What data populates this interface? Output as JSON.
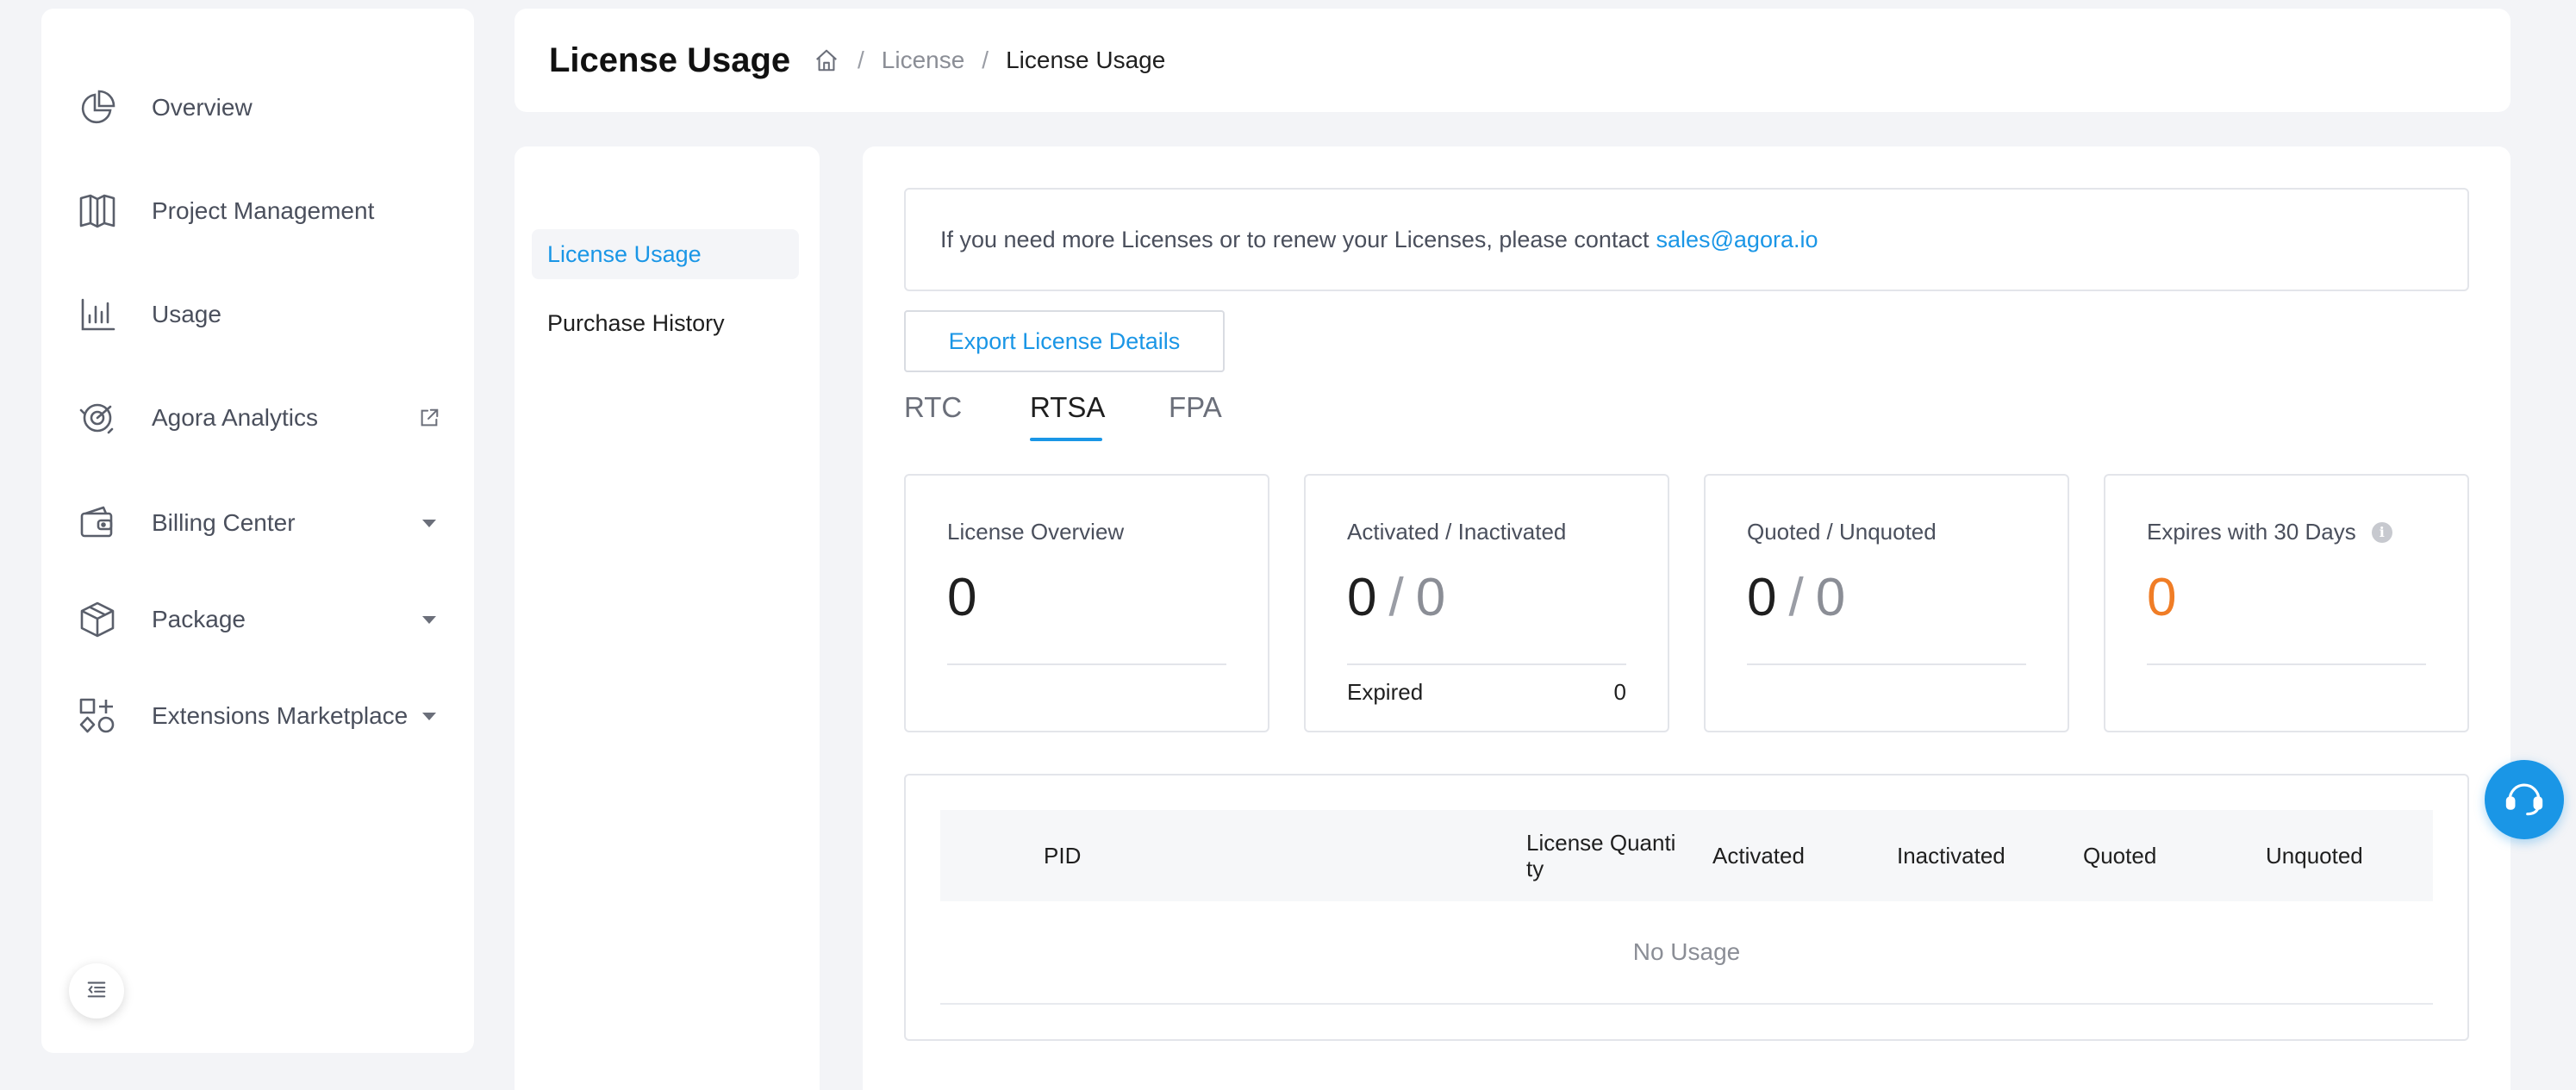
{
  "sidebar": {
    "items": [
      {
        "label": "Overview",
        "icon": "pie-chart-icon"
      },
      {
        "label": "Project Management",
        "icon": "map-icon"
      },
      {
        "label": "Usage",
        "icon": "bar-chart-icon"
      },
      {
        "label": "Agora Analytics",
        "icon": "analytics-icon",
        "trail": "external-link-icon"
      },
      {
        "label": "Billing Center",
        "icon": "wallet-icon",
        "trail": "caret-down-icon"
      },
      {
        "label": "Package",
        "icon": "package-icon",
        "trail": "caret-down-icon"
      },
      {
        "label": "Extensions Marketplace",
        "icon": "extensions-icon",
        "trail": "caret-down-icon"
      }
    ],
    "collapse_icon": "collapse-menu-icon"
  },
  "header": {
    "title": "License Usage",
    "breadcrumb": {
      "home_icon": "home-icon",
      "separator": "/",
      "items": [
        "License",
        "License Usage"
      ]
    }
  },
  "submenu": {
    "items": [
      "License Usage",
      "Purchase History"
    ],
    "active_index": 0
  },
  "main": {
    "notice": {
      "text": "If you need more Licenses or to renew your Licenses, please contact",
      "email": "sales@agora.io"
    },
    "export_label": "Export License Details",
    "tabs": [
      "RTC",
      "RTSA",
      "FPA"
    ],
    "active_tab": 1,
    "cards": [
      {
        "title": "License Overview",
        "value": "0"
      },
      {
        "title": "Activated / Inactivated",
        "value_a": "0",
        "separator": "/",
        "value_b": "0",
        "expired_label": "Expired",
        "expired_value": "0"
      },
      {
        "title": "Quoted / Unquoted",
        "value_a": "0",
        "separator": "/",
        "value_b": "0"
      },
      {
        "title": "Expires with 30 Days",
        "value": "0",
        "info_icon": "info-icon"
      }
    ],
    "table": {
      "columns": [
        "PID",
        "License Quanti\nty",
        "Activated",
        "Inactivated",
        "Quoted",
        "Unquoted"
      ],
      "column_lines": {
        "license_quantity_1": "License Quanti",
        "license_quantity_2": "ty"
      },
      "empty_text": "No Usage"
    }
  },
  "support_icon": "headset-icon",
  "colors": {
    "accent": "#1a96e6",
    "warning": "#f07d26",
    "background": "#f3f4f7"
  }
}
